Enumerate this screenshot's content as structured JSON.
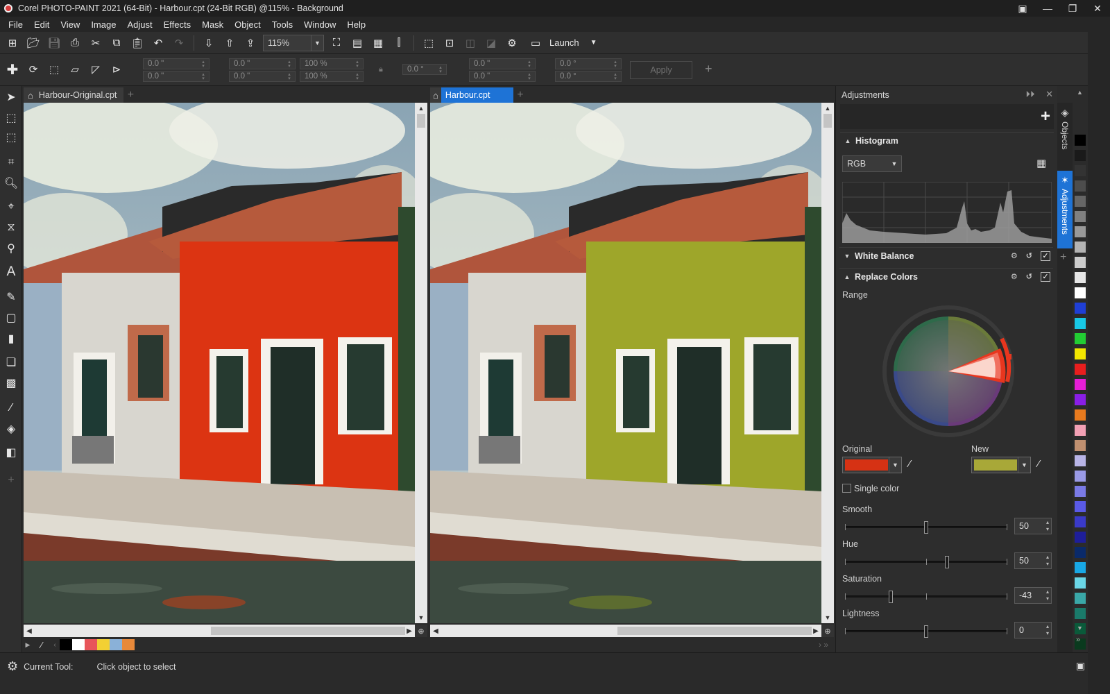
{
  "window": {
    "title": "Corel PHOTO-PAINT 2021 (64-Bit) - Harbour.cpt (24-Bit RGB) @115% - Background"
  },
  "menu": [
    "File",
    "Edit",
    "View",
    "Image",
    "Adjust",
    "Effects",
    "Mask",
    "Object",
    "Tools",
    "Window",
    "Help"
  ],
  "toolbar": {
    "zoom": "115%",
    "launch_label": "Launch"
  },
  "property_bar": {
    "pos_x": "0.0 \"",
    "pos_y": "0.0 \"",
    "size_w": "0.0 \"",
    "size_h": "0.0 \"",
    "scale_w": "100 %",
    "scale_h": "100 %",
    "angle": "0.0 °",
    "center_x": "0.0 \"",
    "center_y": "0.0 \"",
    "skew_x": "0.0 °",
    "skew_y": "0.0 °",
    "apply_label": "Apply"
  },
  "documents": [
    {
      "tab": "Harbour-Original.cpt",
      "active": false,
      "wall_color": "#dc3412"
    },
    {
      "tab": "Harbour.cpt",
      "active": true,
      "wall_color": "#9ea62a"
    }
  ],
  "status": {
    "label": "Current Tool:",
    "value": "Click object to select"
  },
  "docker": {
    "title": "Adjustments",
    "histogram": {
      "title": "Histogram",
      "channel": "RGB"
    },
    "white_balance": {
      "title": "White Balance"
    },
    "replace_colors": {
      "title": "Replace Colors",
      "range_label": "Range",
      "original_label": "Original",
      "new_label": "New",
      "original_color": "#d63214",
      "new_color": "#a8a838",
      "single_color_label": "Single color",
      "sliders": [
        {
          "label": "Smooth",
          "value": "50",
          "fraction": 0.5
        },
        {
          "label": "Hue",
          "value": "50",
          "fraction": 0.63
        },
        {
          "label": "Saturation",
          "value": "-43",
          "fraction": 0.28
        },
        {
          "label": "Lightness",
          "value": "0",
          "fraction": 0.5
        }
      ]
    }
  },
  "side_tabs": {
    "objects": "Objects",
    "adjustments": "Adjustments"
  },
  "bottom_swatches": [
    "#000000",
    "#ffffff",
    "#e8555a",
    "#f2d033",
    "#8ab1d8",
    "#e8893a"
  ],
  "palette": [
    "#000000",
    "#1a1a1a",
    "#333333",
    "#4d4d4d",
    "#666666",
    "#808080",
    "#999999",
    "#b3b3b3",
    "#cccccc",
    "#e6e6e6",
    "#ffffff",
    "#1f3fd6",
    "#18c8e6",
    "#22cc33",
    "#f2e600",
    "#e81e1e",
    "#e61ed6",
    "#8a1ee6",
    "#e87a1e",
    "#f2a0b4",
    "#c09070",
    "#b8b4e6",
    "#9a9ae6",
    "#7a7ae6",
    "#5a5ae6",
    "#3a3ac8",
    "#1e1e9a",
    "#0a2a6a",
    "#18a8e6",
    "#6ad6e6",
    "#3aa8a8",
    "#1a7a6a",
    "#0a5a3a",
    "#0a3a1e"
  ]
}
